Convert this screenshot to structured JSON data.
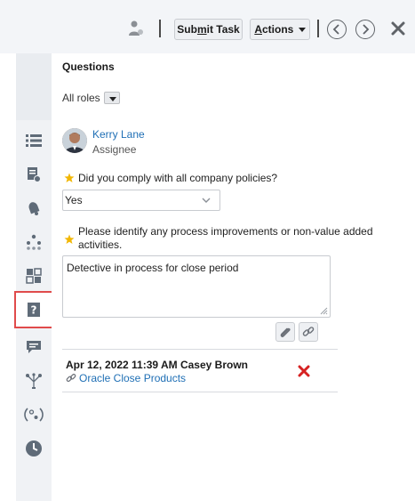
{
  "toolbar": {
    "submit_label_pre": "Sub",
    "submit_label_u": "m",
    "submit_label_post": "it Task",
    "actions_label_u": "A",
    "actions_label_post": "ctions"
  },
  "panel": {
    "title": "Questions",
    "roles_label": "All roles"
  },
  "assignee": {
    "name": "Kerry Lane",
    "role": "Assignee"
  },
  "questions": [
    {
      "text": "Did you comply with all company policies?",
      "answer": "Yes"
    },
    {
      "text": "Please identify any process improvements or non-value added activities.",
      "answer": "Detective in process for close period"
    }
  ],
  "log": {
    "when": "Apr 12, 2022 11:39 AM  Casey Brown",
    "link_text": "Oracle Close Products"
  },
  "colors": {
    "link": "#1f6fb5",
    "star": "#f2b705",
    "delete": "#d62222",
    "active_highlight": "#e04b4b"
  },
  "rail_icons": [
    "list-icon",
    "document-icon",
    "bell-icon",
    "hierarchy-icon",
    "grid-icon",
    "question-icon",
    "comment-icon",
    "workflow-icon",
    "variable-icon",
    "clock-icon"
  ]
}
